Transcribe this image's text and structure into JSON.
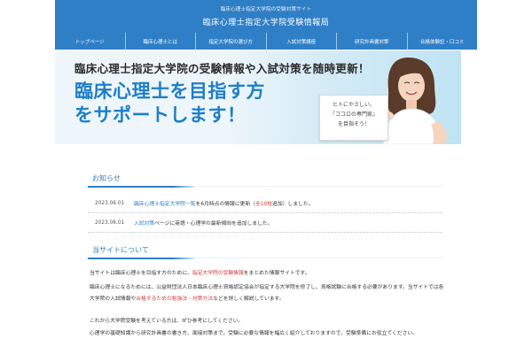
{
  "header": {
    "tagline": "臨床心理士指定大学院の受験対策サイト",
    "site_title": "臨床心理士指定大学院受験情報局"
  },
  "nav": {
    "items": [
      {
        "label": "トップページ"
      },
      {
        "label": "臨床心理士とは"
      },
      {
        "label": "指定大学院の選び方"
      },
      {
        "label": "入試対策講座"
      },
      {
        "label": "研究計画書対策"
      },
      {
        "label": "合格体験記・口コミ"
      }
    ]
  },
  "banner": {
    "line1": "臨床心理士指定大学院の受験情報や入試対策を随時更新！",
    "line2": "臨床心理士を目指す方",
    "line3": "をサポートします！",
    "card_lines": [
      "ヒトにやさしい、",
      "『ココロの専門家』",
      "を目指そう！"
    ]
  },
  "news": {
    "heading": "お知らせ",
    "items": [
      {
        "date": "2023.06.01",
        "link_text": "臨床心理士指定大学院一覧",
        "text_a": "を6月時点の情報に更新（",
        "red_text": "全10校",
        "text_b": "追加）しました。"
      },
      {
        "date": "2023.06.01",
        "link_text": "入試対策",
        "text_a": "ページに英語・心理学の最新傾向を追加しました。",
        "red_text": "",
        "text_b": ""
      }
    ]
  },
  "about": {
    "heading": "当サイトについて",
    "p1_a": "当サイトは臨床心理士を目指す方のために、",
    "p1_red": "指定大学院の受験情報",
    "p1_b": "をまとめた情報サイトです。",
    "p2_a": "臨床心理士になるためには、公益財団法人日本臨床心理士資格認定協会が指定する大学院を修了し、資格試験に合格する必要があります。当サイトでは各大学院の入試情報や",
    "p2_red": "合格するための勉強法・対策方法",
    "p2_b": "などを詳しく解説しています。",
    "p3": "これから大学院受験を考えている方は、ぜひ参考にしてください。",
    "p4": "心理学の基礎知識から研究計画書の書き方、面接対策まで、受験に必要な情報を幅広く紹介しておりますので、受験準備にお役立てください。"
  },
  "colors": {
    "brand_blue": "#2f7fc7",
    "accent_red": "#d63b3b"
  }
}
